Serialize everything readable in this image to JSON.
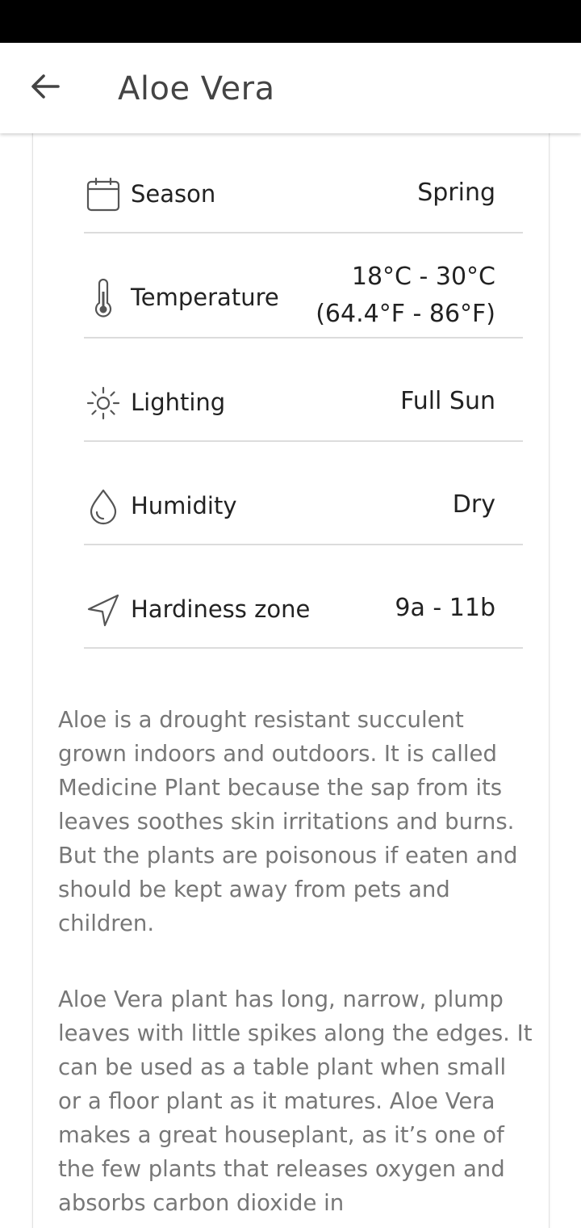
{
  "app_bar": {
    "title": "Aloe Vera",
    "back_icon": "arrow-left-icon"
  },
  "details": [
    {
      "icon": "calendar-icon",
      "label": "Season",
      "value": "Spring"
    },
    {
      "icon": "thermometer-icon",
      "label": "Temperature",
      "value_line1": "18°C - 30°C",
      "value_line2": "(64.4°F - 86°F)"
    },
    {
      "icon": "sun-icon",
      "label": "Lighting",
      "value": "Full Sun"
    },
    {
      "icon": "water-drop-icon",
      "label": "Humidity",
      "value": "Dry"
    },
    {
      "icon": "navigation-arrow-icon",
      "label": "Hardiness zone",
      "value": "9a - 11b"
    }
  ],
  "description": {
    "paragraph1": "Aloe is a drought resistant succulent grown indoors and outdoors. It is called Medicine Plant because the sap from its leaves soothes skin irritations and burns. But the plants are poisonous if eaten and should be kept away from pets and children.",
    "paragraph2": "Aloe Vera plant has long, narrow, plump leaves with little spikes along the edges. It can be used as a table plant when small or a floor plant as it matures. Aloe Vera makes a great houseplant, as it’s one of the few plants that releases oxygen and absorbs carbon dioxide in"
  }
}
